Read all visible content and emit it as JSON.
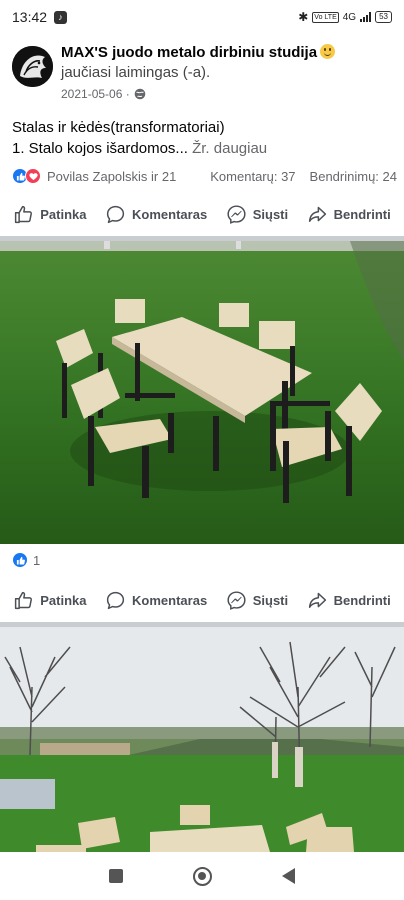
{
  "status_bar": {
    "time": "13:42",
    "app_icon": "tiktok-icon",
    "network": "4G",
    "volte": "Vo LTE",
    "battery": "53"
  },
  "post": {
    "page_name": "MAX'S juodo metalo dirbiniu studija",
    "feeling": "jaučiasi laimingas (-a).",
    "date": "2021-05-06 ·",
    "text_line1": "Stalas ir kėdės(transformatoriai)",
    "text_line2": "1. Stalo kojos išardomos...",
    "see_more": " Žr. daugiau",
    "reactors": "Povilas Zapolskis ir 21",
    "comments": "Komentarų: 37",
    "shares": "Bendrinimų: 24",
    "photo_likes": "1"
  },
  "actions": {
    "like": "Patinka",
    "comment": "Komentaras",
    "send": "Siųsti",
    "share": "Bendrinti"
  },
  "colors": {
    "facebook_blue": "#1877f2",
    "love_red": "#f33e58",
    "secondary_text": "#65676b",
    "grass": "#2f6b1f"
  },
  "icons": {
    "like": "thumbs-up-icon",
    "comment": "comment-bubble-icon",
    "send": "messenger-icon",
    "share": "share-arrow-icon",
    "privacy": "globe-icon"
  }
}
